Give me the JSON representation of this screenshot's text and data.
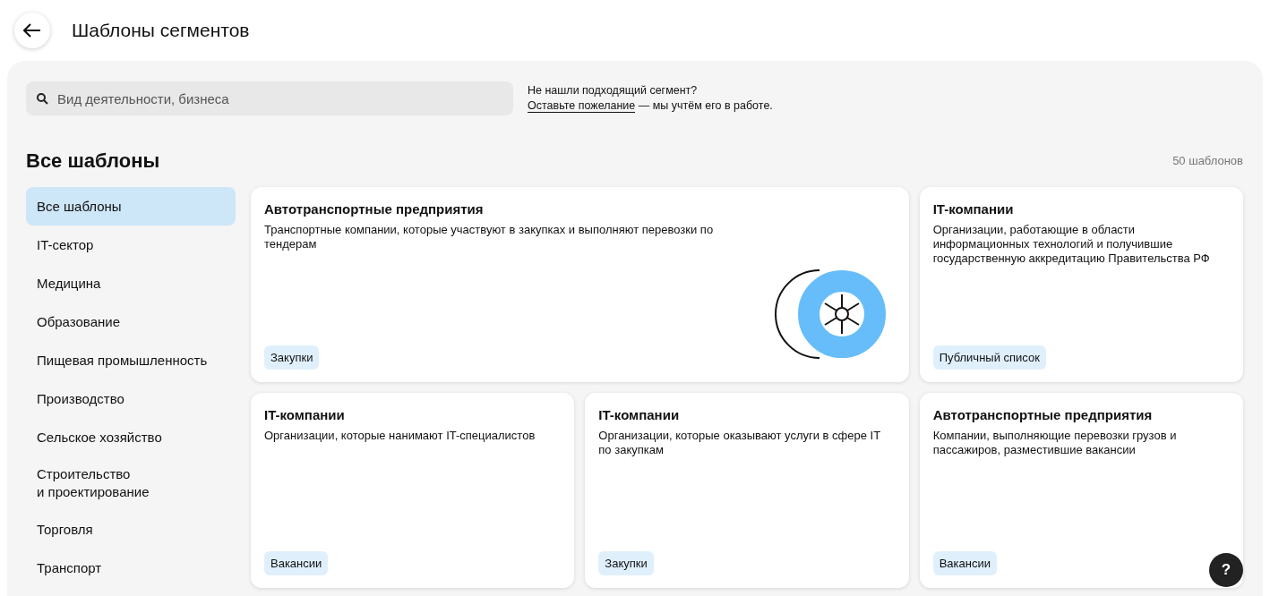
{
  "header": {
    "title": "Шаблоны сегментов"
  },
  "search": {
    "placeholder": "Вид деятельности, бизнеса"
  },
  "feedback": {
    "question": "Не нашли подходящий сегмент?",
    "link": "Оставьте пожелание",
    "rest": "— мы учтём его в работе."
  },
  "section": {
    "title": "Все шаблоны",
    "count": "50 шаблонов"
  },
  "sidebar": {
    "items": [
      {
        "label": "Все шаблоны",
        "selected": true
      },
      {
        "label": "IT-сектор",
        "selected": false
      },
      {
        "label": "Медицина",
        "selected": false
      },
      {
        "label": "Образование",
        "selected": false
      },
      {
        "label": "Пищевая промышленность",
        "selected": false
      },
      {
        "label": "Производство",
        "selected": false
      },
      {
        "label": "Сельское хозяйство",
        "selected": false
      },
      {
        "label": "Строительство\nи проектирование",
        "selected": false
      },
      {
        "label": "Торговля",
        "selected": false
      },
      {
        "label": "Транспорт",
        "selected": false
      }
    ]
  },
  "cards": [
    {
      "kind": "wide",
      "title": "Автотранспортные предприятия",
      "description": "Транспортные компании, которые участвуют в закупках и выполняют перевозки по тендерам",
      "tag": "Закупки"
    },
    {
      "kind": "normal",
      "title": "IT-компании",
      "description": "Организации, работающие в области информационных технологий и получившие государственную аккредитацию Правительства РФ",
      "tag": "Публичный список"
    },
    {
      "kind": "normal",
      "title": "IT-компании",
      "description": "Организации, которые нанимают IT-специалистов",
      "tag": "Вакансии"
    },
    {
      "kind": "normal",
      "title": "IT-компании",
      "description": "Организации, которые оказывают услуги в сфере IT по закупкам",
      "tag": "Закупки"
    },
    {
      "kind": "normal",
      "title": "Автотранспортные предприятия",
      "description": "Компании, выполняющие перевозки грузов и пассажиров, разместившие вакансии",
      "tag": "Вакансии"
    }
  ],
  "help": {
    "label": "?"
  }
}
